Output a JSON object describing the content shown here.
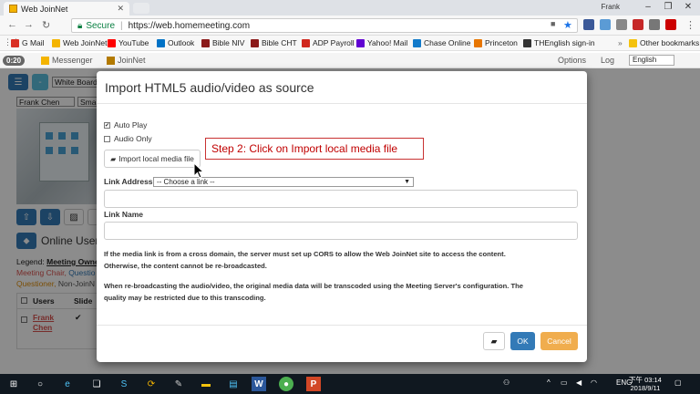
{
  "browser": {
    "tab_title": "Web JoinNet",
    "user": "Frank",
    "secure_label": "Secure",
    "url": "https://web.homemeeting.com"
  },
  "bookmarks": [
    {
      "label": "G Mail",
      "color": "#d93025"
    },
    {
      "label": "Web JoinNet",
      "color": "#f4b400"
    },
    {
      "label": "YouTube",
      "color": "#ff0000"
    },
    {
      "label": "Outlook",
      "color": "#0072c6"
    },
    {
      "label": "Bible NIV",
      "color": "#8b1a1a"
    },
    {
      "label": "Bible CHT",
      "color": "#8b1a1a"
    },
    {
      "label": "ADP Payroll",
      "color": "#d0271d"
    },
    {
      "label": "Yahoo! Mail",
      "color": "#6001d2"
    },
    {
      "label": "Chase Online",
      "color": "#117aca"
    },
    {
      "label": "Princeton",
      "color": "#e77500"
    },
    {
      "label": "THEnglish sign-in",
      "color": "#333333"
    },
    {
      "label": "Other bookmarks",
      "color": "#f4c20d"
    }
  ],
  "app_nav": {
    "timer": "0:20",
    "messenger": "Messenger",
    "joinnet": "JoinNet",
    "options": "Options",
    "log": "Log",
    "language": "English"
  },
  "background": {
    "board_select": "White Board",
    "user_select": "Frank Chen",
    "size_select": "Sma",
    "online_users": "Online Users",
    "legend_label": "Legend:",
    "legend_owner": "Meeting Owne",
    "legend_chair": "Meeting Chair,",
    "legend_questioner": "Questio",
    "legend_questioner2": "Questioner,",
    "legend_nonjoin": "Non-JoinN",
    "col_users": "Users",
    "col_slide": "Slide",
    "user_first": "Frank",
    "user_last": "Chen",
    "checkmark": "✔"
  },
  "modal": {
    "title": "Import HTML5 audio/video as source",
    "auto_play": "Auto Play",
    "auto_play_checked": true,
    "audio_only": "Audio Only",
    "audio_only_checked": false,
    "import_button": "Import local media file",
    "link_address_label": "Link Address",
    "link_address_value": "-- Choose a link --",
    "link_name_label": "Link Name",
    "note_cors_1": "If the media link is from a cross domain, the server must set up CORS to allow the Web JoinNet site to access the content.",
    "note_cors_2": "Otherwise, the content cannot be re-broadcasted.",
    "note_transcode_1": "When re-broadcasting the audio/video, the original media data will be transcoded using the Meeting Server's configuration. The",
    "note_transcode_2": "quality may be restricted due to this transcoding.",
    "ok_button": "OK",
    "cancel_button": "Cancel"
  },
  "callout": {
    "text": "Step 2: Click on Import local media file",
    "color": "#c00000"
  },
  "taskbar": {
    "lang": "ENG",
    "time": "下午 03:14",
    "date": "2018/9/11"
  }
}
